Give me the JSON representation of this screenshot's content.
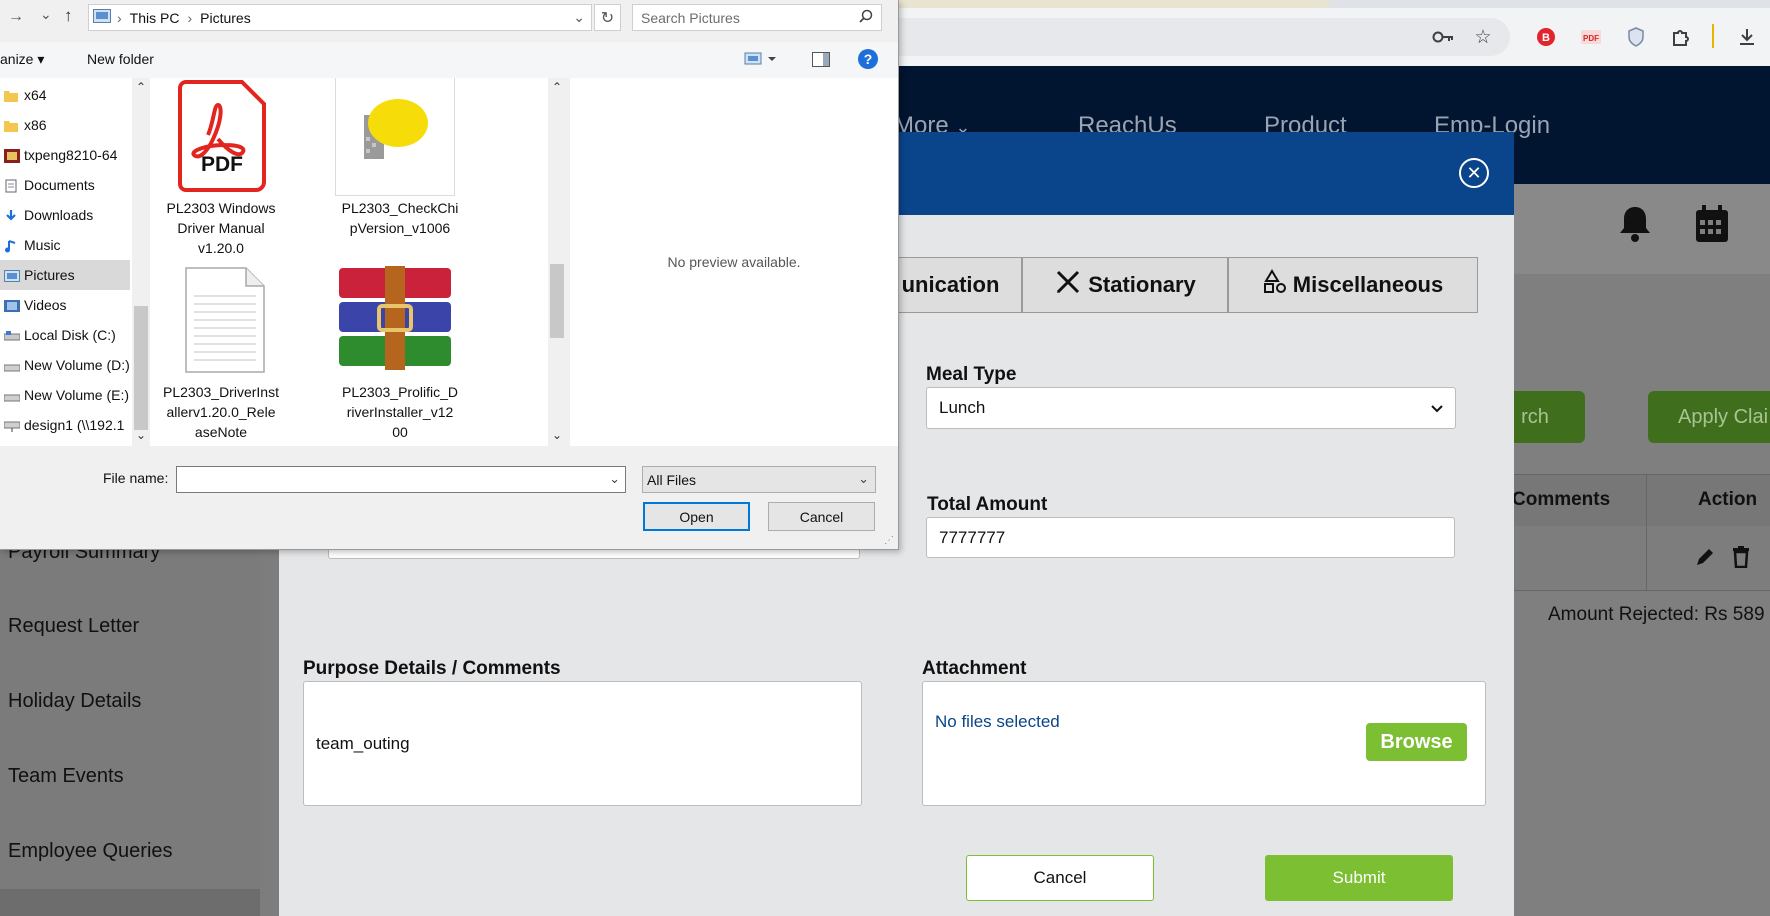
{
  "browser": {
    "icons": [
      "key-icon",
      "star-icon",
      "extension-red-icon",
      "extension-pdf-icon",
      "shield-icon",
      "puzzle-icon",
      "download-icon"
    ]
  },
  "site": {
    "nav": [
      "More",
      "ReachUs",
      "Product",
      "Emp-Login"
    ],
    "sidebar": [
      "Payroll Summary",
      "Request Letter",
      "Holiday Details",
      "Team Events",
      "Employee Queries"
    ],
    "search_button": "rch",
    "apply_button": "Apply Clai",
    "table_headers": [
      "Comments",
      "Action"
    ],
    "amount_rejected": "Amount Rejected: Rs 589"
  },
  "modal": {
    "tabs": [
      "unication",
      "Stationary",
      "Miscellaneous"
    ],
    "meal_type": {
      "label": "Meal Type",
      "value": "Lunch"
    },
    "total_amount": {
      "label": "Total Amount",
      "value": "7777777"
    },
    "purpose": {
      "label": "Purpose Details / Comments",
      "value": "team_outing"
    },
    "attachment": {
      "label": "Attachment",
      "status": "No files selected",
      "browse": "Browse"
    },
    "cancel": "Cancel",
    "submit": "Submit",
    "accent": "#7cbf33",
    "header_color": "#0a448a"
  },
  "dialog": {
    "breadcrumb": [
      "This PC",
      "Pictures"
    ],
    "search_placeholder": "Search Pictures",
    "toolbar": {
      "organize": "anize ▾",
      "new_folder": "New folder",
      "help": "?"
    },
    "nav_items": [
      {
        "label": "x64",
        "icon": "folder-icon"
      },
      {
        "label": "x86",
        "icon": "folder-icon"
      },
      {
        "label": "txpeng8210-64",
        "icon": "app-icon"
      },
      {
        "label": "Documents",
        "icon": "documents-icon"
      },
      {
        "label": "Downloads",
        "icon": "downloads-icon"
      },
      {
        "label": "Music",
        "icon": "music-icon"
      },
      {
        "label": "Pictures",
        "icon": "pictures-icon",
        "selected": true
      },
      {
        "label": "Videos",
        "icon": "videos-icon"
      },
      {
        "label": "Local Disk (C:)",
        "icon": "disk-icon"
      },
      {
        "label": "New Volume (D:)",
        "icon": "drive-icon"
      },
      {
        "label": "New Volume (E:)",
        "icon": "drive-icon"
      },
      {
        "label": "design1 (\\\\192.1",
        "icon": "network-drive-icon"
      }
    ],
    "files": [
      {
        "name": "PL2303 Windows Driver Manual v1.20.0",
        "lines": [
          "PL2303 Windows",
          "Driver Manual",
          "v1.20.0"
        ],
        "icon_text": "PDF"
      },
      {
        "name": "PL2303_CheckChipVersion_v1006",
        "lines": [
          "PL2303_CheckChi",
          "pVersion_v1006"
        ]
      },
      {
        "name": "PL2303_DriverInstallerv1.20.0_ReleaseNote",
        "lines": [
          "PL2303_DriverInst",
          "allerv1.20.0_Rele",
          "aseNote"
        ]
      },
      {
        "name": "PL2303_Prolific_DriverInstaller_v1200",
        "lines": [
          "PL2303_Prolific_D",
          "riverInstaller_v12",
          "00"
        ]
      }
    ],
    "preview": "No preview available.",
    "file_name_label": "File name:",
    "file_name_value": "",
    "file_type": "All Files",
    "open": "Open",
    "cancel": "Cancel"
  }
}
